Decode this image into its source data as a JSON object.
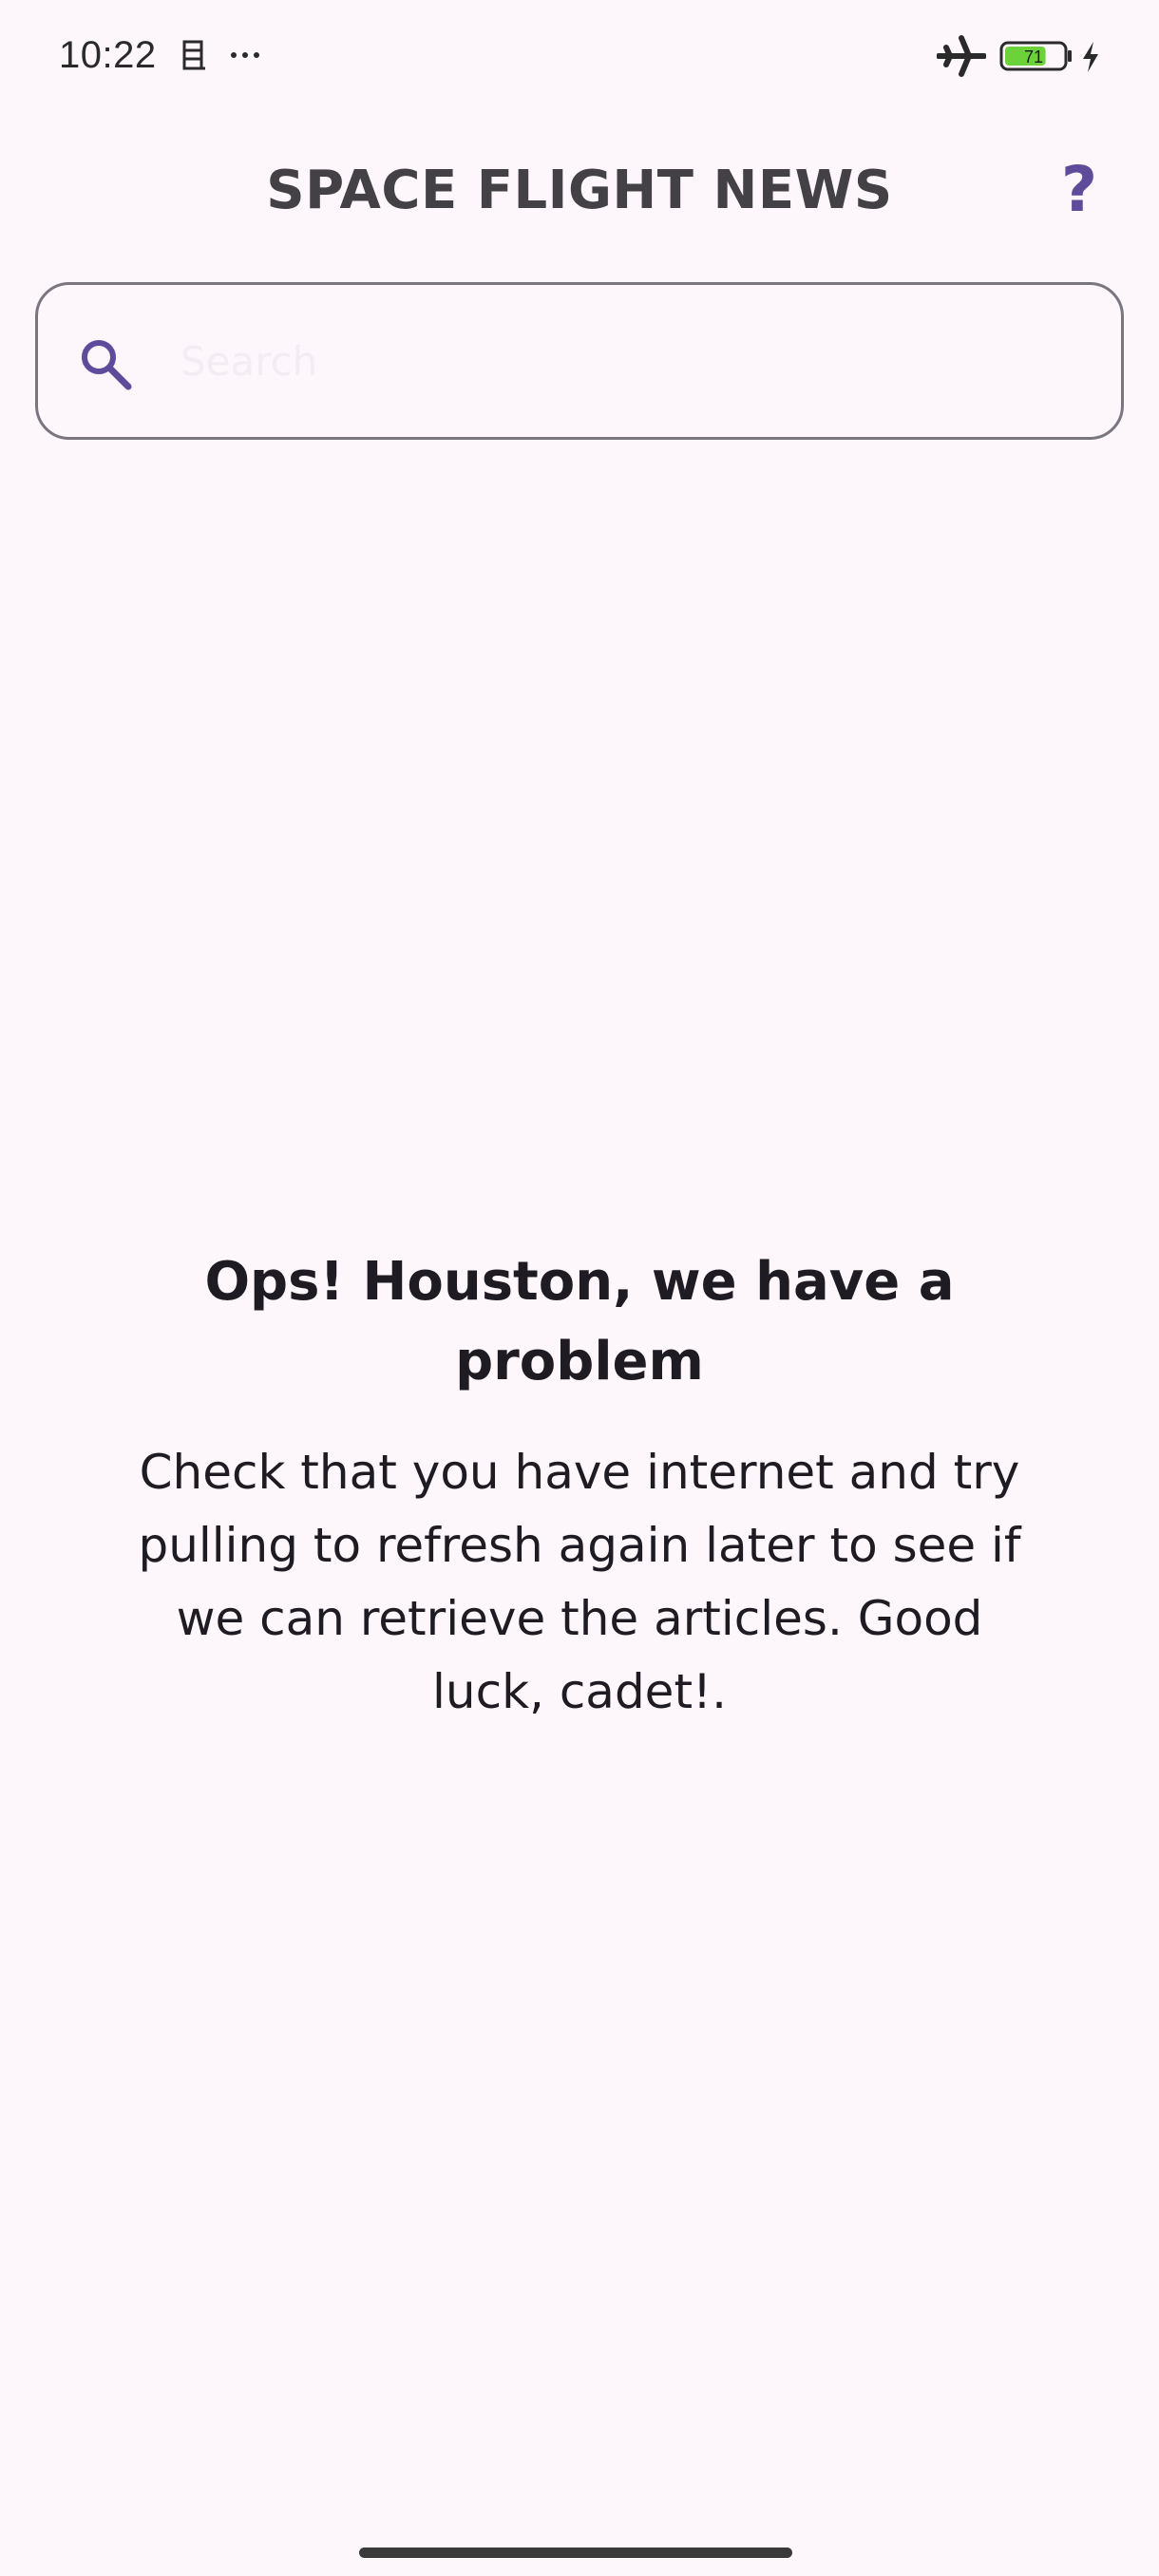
{
  "status_bar": {
    "time": "10:22",
    "battery_level": "71",
    "icons": [
      "notification-icon",
      "more-dots-icon",
      "airplane-mode-icon",
      "battery-icon",
      "charging-icon"
    ]
  },
  "app_bar": {
    "title": "SPACE FLIGHT NEWS",
    "help_label": "?"
  },
  "search": {
    "placeholder": "Search",
    "value": ""
  },
  "error": {
    "title": "Ops! Houston, we have a problem",
    "message": "Check that you have internet and try pulling to refresh again later to see if we can retrieve the articles. Good luck, cadet!."
  },
  "colors": {
    "background": "#fdf7fc",
    "accent": "#5e4b9a",
    "title_text": "#434046",
    "body_text": "#1f1b22",
    "outline": "#7a7680",
    "battery_fill": "#6bd23a"
  }
}
